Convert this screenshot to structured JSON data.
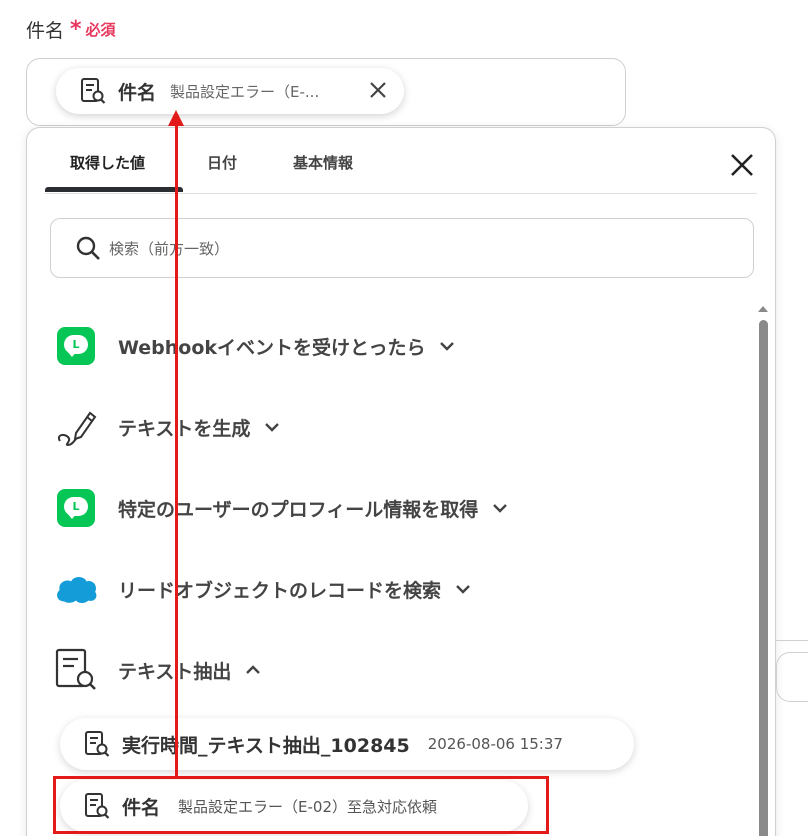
{
  "field": {
    "label": "件名",
    "required_mark": "*",
    "required_text": "必須",
    "selected_chip": {
      "name": "件名",
      "value": "製品設定エラー（E-...",
      "icon": "document-search-icon"
    }
  },
  "panel": {
    "tabs": [
      {
        "label": "取得した値",
        "active": true
      },
      {
        "label": "日付",
        "active": false
      },
      {
        "label": "基本情報",
        "active": false
      }
    ],
    "search_placeholder": "検索（前方一致）",
    "sections": [
      {
        "label": "Webhookイベントを受けとったら",
        "icon": "line-icon",
        "expanded": false
      },
      {
        "label": "テキストを生成",
        "icon": "pen-icon",
        "expanded": false
      },
      {
        "label": "特定のユーザーのプロフィール情報を取得",
        "icon": "line-icon",
        "expanded": false
      },
      {
        "label": "リードオブジェクトのレコードを検索",
        "icon": "salesforce-cloud-icon",
        "expanded": false
      },
      {
        "label": "テキスト抽出",
        "icon": "document-search-icon",
        "expanded": true
      }
    ],
    "values": [
      {
        "name": "実行時間_テキスト抽出_102845",
        "value": "2026-08-06 15:37"
      },
      {
        "name": "件名",
        "value": "製品設定エラー（E-02）至急対応依頼"
      }
    ]
  },
  "colors": {
    "required": "#e8365c",
    "annotation": "#e21a1a",
    "line_green": "#06c755",
    "salesforce_blue": "#139cd8"
  }
}
